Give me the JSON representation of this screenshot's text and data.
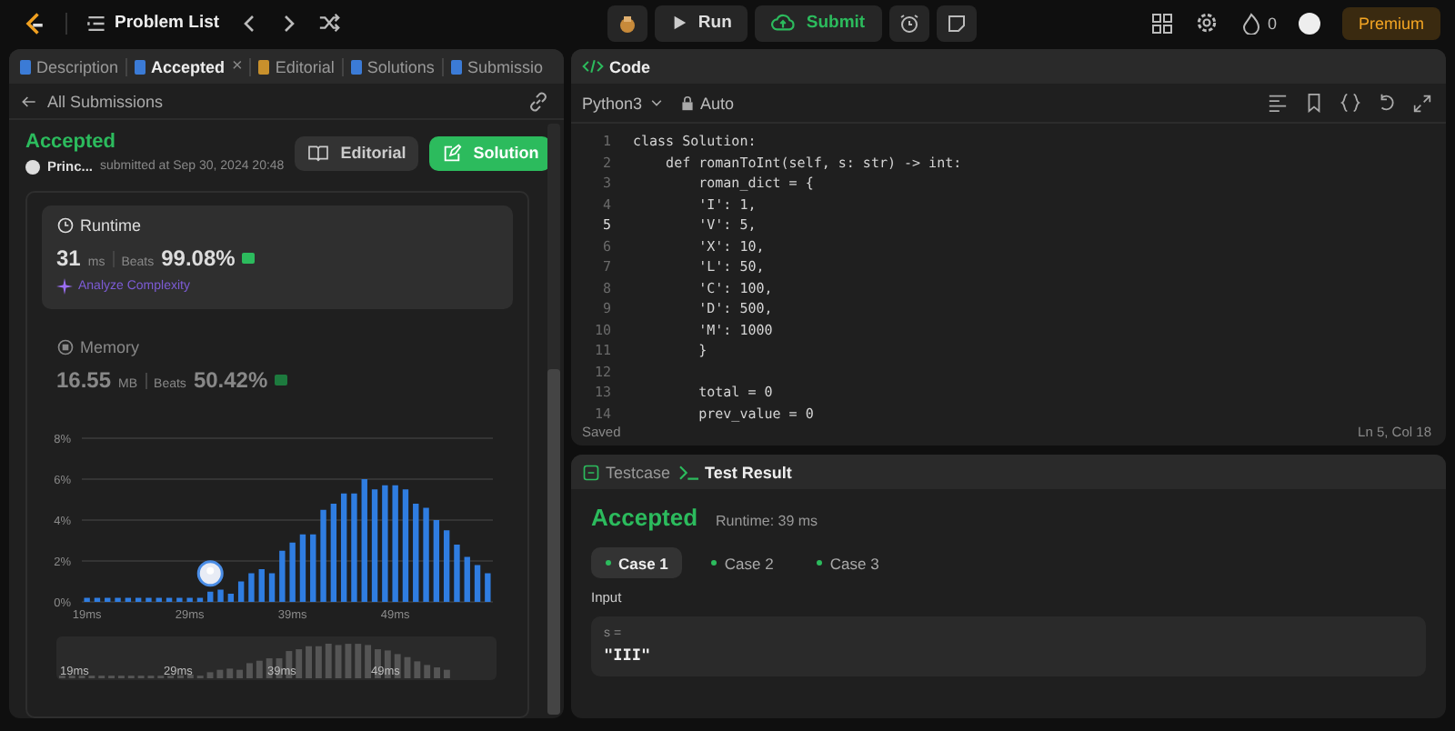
{
  "topbar": {
    "title": "Problem List",
    "run": "Run",
    "submit": "Submit",
    "streak": "0",
    "premium": "Premium"
  },
  "left_tabs": [
    {
      "label": "Description",
      "selected": false
    },
    {
      "label": "Accepted",
      "selected": true,
      "close": "×"
    },
    {
      "label": "Editorial",
      "selected": false
    },
    {
      "label": "Solutions",
      "selected": false
    },
    {
      "label": "Submissio",
      "selected": false
    }
  ],
  "back_link": "All Submissions",
  "submission": {
    "status": "Accepted",
    "user": "Princ...",
    "submitted": "submitted at Sep 30, 2024 20:48",
    "editorial_button": "Editorial",
    "solution_button": "Solution"
  },
  "metrics": [
    {
      "kind": "runtime",
      "title": "Runtime",
      "value": "31",
      "unit": "ms",
      "beats_label": "Beats",
      "beats": "99.08%",
      "selected": true,
      "link": "Analyze Complexity"
    },
    {
      "kind": "memory",
      "title": "Memory",
      "value": "16.55",
      "unit": "MB",
      "beats_label": "Beats",
      "beats": "50.42%",
      "selected": false
    }
  ],
  "chart_data": {
    "type": "bar",
    "x": [
      19,
      20,
      21,
      22,
      23,
      24,
      25,
      26,
      27,
      28,
      29,
      30,
      31,
      32,
      33,
      34,
      35,
      36,
      37,
      38,
      39,
      40,
      41,
      42,
      43,
      44,
      45,
      46,
      47,
      48,
      49,
      50,
      51,
      52,
      53,
      54,
      55,
      56,
      57,
      58
    ],
    "values": [
      0.2,
      0.2,
      0.2,
      0.2,
      0.2,
      0.2,
      0.2,
      0.2,
      0.2,
      0.2,
      0.2,
      0.2,
      0.5,
      0.6,
      0.4,
      1.0,
      1.4,
      1.6,
      1.4,
      2.5,
      2.9,
      3.3,
      3.3,
      4.5,
      4.8,
      5.3,
      5.3,
      6.0,
      5.5,
      5.7,
      5.7,
      5.5,
      4.8,
      4.6,
      4.0,
      3.5,
      2.8,
      2.2,
      1.8,
      1.4
    ],
    "xlim": [
      18.5,
      58.5
    ],
    "ylim": [
      0,
      8
    ],
    "grid": true,
    "yticks": [
      {
        "value": 0,
        "label": "0%"
      },
      {
        "value": 2,
        "label": "2%"
      },
      {
        "value": 4,
        "label": "4%"
      },
      {
        "value": 6,
        "label": "6%"
      },
      {
        "value": 8,
        "label": "8%"
      }
    ],
    "xticks": [
      {
        "value": 19,
        "label": "19ms"
      },
      {
        "value": 29,
        "label": "29ms"
      },
      {
        "value": 39,
        "label": "39ms"
      },
      {
        "value": 49,
        "label": "49ms"
      }
    ]
  },
  "overview_labels": [
    "19ms",
    "29ms",
    "39ms",
    "49ms"
  ],
  "editor": {
    "title": "Code",
    "language": "Python3",
    "mode": "Auto",
    "status": "Saved",
    "position": "Ln 5, Col 18",
    "lines": [
      {
        "number": "1",
        "code": "class Solution:",
        "current": false
      },
      {
        "number": "2",
        "code": "    def romanToInt(self, s: str) -> int:",
        "current": false
      },
      {
        "number": "3",
        "code": "        roman_dict = {",
        "current": false
      },
      {
        "number": "4",
        "code": "        'I': 1,",
        "current": false
      },
      {
        "number": "5",
        "code": "        'V': 5,",
        "current": true
      },
      {
        "number": "6",
        "code": "        'X': 10,",
        "current": false
      },
      {
        "number": "7",
        "code": "        'L': 50,",
        "current": false
      },
      {
        "number": "8",
        "code": "        'C': 100,",
        "current": false
      },
      {
        "number": "9",
        "code": "        'D': 500,",
        "current": false
      },
      {
        "number": "10",
        "code": "        'M': 1000",
        "current": false
      },
      {
        "number": "11",
        "code": "        }",
        "current": false
      },
      {
        "number": "12",
        "current": false
      },
      {
        "number": "13",
        "code": "        total = 0",
        "current": false
      },
      {
        "number": "14",
        "code": "        prev_value = 0",
        "current": false
      }
    ]
  },
  "bottom_tabs": [
    {
      "label": "Testcase",
      "selected": false
    },
    {
      "label": "Test Result",
      "selected": true
    }
  ],
  "result": {
    "status": "Accepted",
    "runtime": "Runtime: 39 ms",
    "cases": [
      {
        "label": "Case 1",
        "selected": true,
        "passed": true
      },
      {
        "label": "Case 2",
        "selected": false,
        "passed": true
      },
      {
        "label": "Case 3",
        "selected": false,
        "passed": true
      }
    ],
    "input_label": "Input",
    "var_name": "s =",
    "var_value": "\"III\""
  }
}
